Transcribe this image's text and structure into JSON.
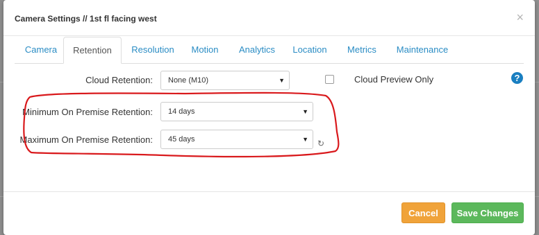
{
  "dialog": {
    "title": "Camera Settings // 1st fl facing west",
    "close_glyph": "×"
  },
  "tabs": [
    {
      "label": "Camera"
    },
    {
      "label": "Retention",
      "active": true
    },
    {
      "label": "Resolution"
    },
    {
      "label": "Motion"
    },
    {
      "label": "Analytics"
    },
    {
      "label": "Location"
    },
    {
      "label": "Metrics"
    },
    {
      "label": "Maintenance"
    }
  ],
  "form": {
    "cloud_retention": {
      "label": "Cloud Retention:",
      "value": "None (M10)"
    },
    "cloud_preview": {
      "label": "Cloud Preview Only",
      "checked": false
    },
    "min_retention": {
      "label": "Minimum On Premise Retention:",
      "value": "14 days"
    },
    "max_retention": {
      "label": "Maximum On Premise Retention:",
      "value": "45 days"
    },
    "help_glyph": "?",
    "reset_glyph": "↻",
    "caret_glyph": "▼"
  },
  "footer": {
    "cancel_label": "Cancel",
    "save_label": "Save Changes"
  },
  "colors": {
    "accent": "#2a8cc4",
    "cancel": "#f0a33a",
    "save": "#5cb85c",
    "annotation": "#d9191c"
  },
  "icons": [
    "close-icon",
    "help-icon",
    "reset-icon",
    "chevron-down-icon"
  ]
}
